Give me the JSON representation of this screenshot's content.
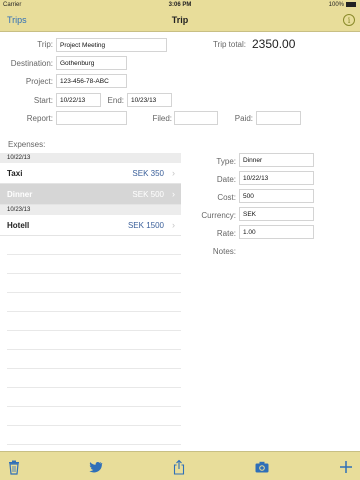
{
  "status": {
    "carrier": "Carrier",
    "time": "3:06 PM",
    "battery": "100%"
  },
  "nav": {
    "back_label": "Trips",
    "title": "Trip",
    "info_icon": "info-icon"
  },
  "trip": {
    "trip_label": "Trip:",
    "trip_value": "Project Meeting",
    "total_label": "Trip total:",
    "total_value": "2350.00",
    "destination_label": "Destination:",
    "destination_value": "Gothenburg",
    "project_label": "Project:",
    "project_value": "123-456-78-ABC",
    "start_label": "Start:",
    "start_value": "10/22/13",
    "end_label": "End:",
    "end_value": "10/23/13",
    "report_label": "Report:",
    "report_value": "",
    "filed_label": "Filed:",
    "filed_value": "",
    "paid_label": "Paid:",
    "paid_value": ""
  },
  "expenses": {
    "title": "Expenses:",
    "sections": [
      {
        "date": "10/22/13",
        "items": [
          {
            "name": "Taxi",
            "amount": "SEK 350",
            "selected": false
          },
          {
            "name": "Dinner",
            "amount": "SEK 500",
            "selected": true
          }
        ]
      },
      {
        "date": "10/23/13",
        "items": [
          {
            "name": "Hotell",
            "amount": "SEK 1500",
            "selected": false
          }
        ]
      }
    ]
  },
  "detail": {
    "type_label": "Type:",
    "type_value": "Dinner",
    "date_label": "Date:",
    "date_value": "10/22/13",
    "cost_label": "Cost:",
    "cost_value": "500",
    "currency_label": "Currency:",
    "currency_value": "SEK",
    "rate_label": "Rate:",
    "rate_value": "1.00",
    "notes_label": "Notes:"
  },
  "toolbar": {
    "icons": [
      "trash-icon",
      "twitter-icon",
      "share-icon",
      "camera-icon",
      "add-icon"
    ],
    "tint": "#2f6fb8"
  },
  "colors": {
    "bar": "#e8dd9a",
    "accent": "#2f6fb8",
    "selected_row": "#d6d6d6"
  }
}
